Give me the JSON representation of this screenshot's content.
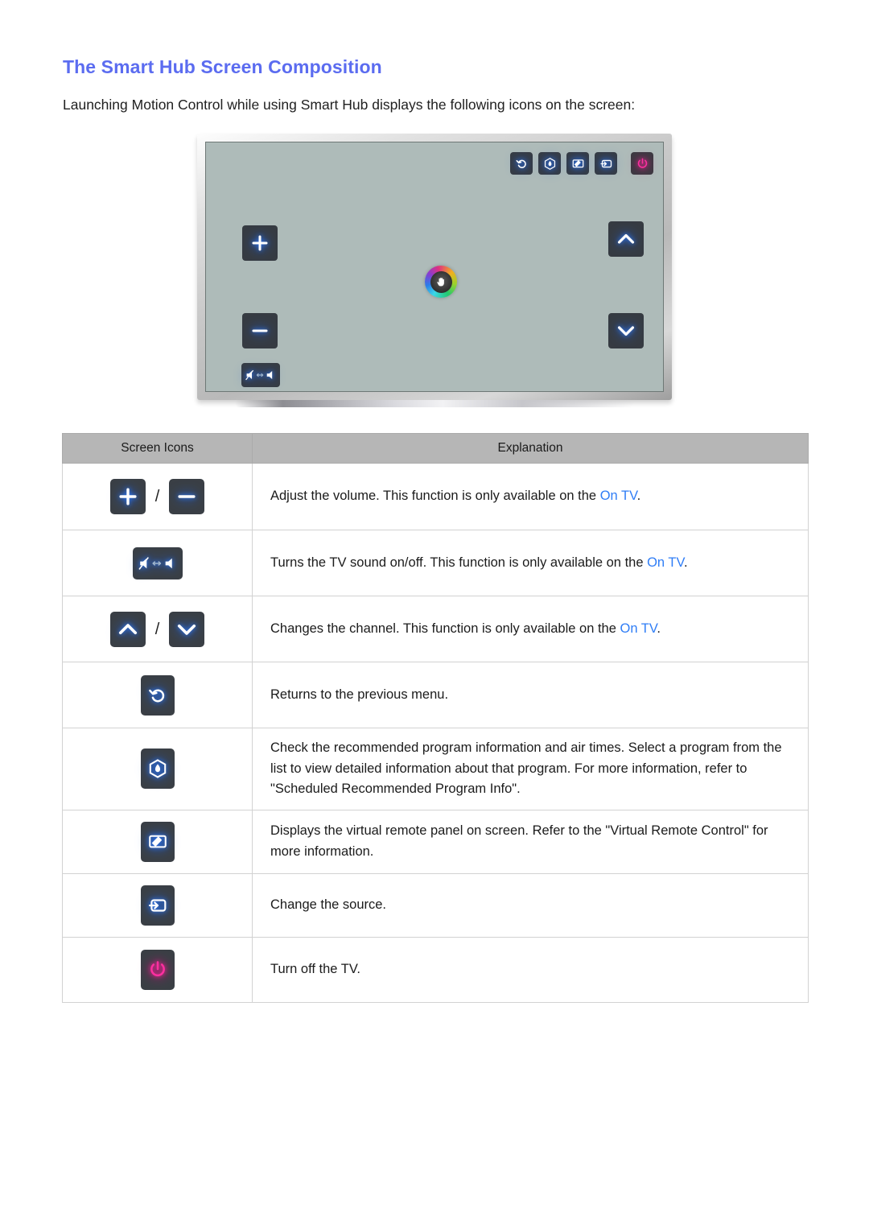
{
  "document": {
    "title": "The Smart Hub Screen Composition",
    "intro": "Launching Motion Control while using Smart Hub displays the following icons on the screen:"
  },
  "colors": {
    "title": "#5b6cf0",
    "link": "#2f7df6",
    "icon_glow_blue": "#2e7bff",
    "icon_glow_pink": "#ff2fa0",
    "icon_chip_bg": "#3a3f45",
    "tv_screen_bg": "#aebbb9",
    "table_header_bg": "#b6b6b6"
  },
  "tv_illustration": {
    "name": "smart-hub-tv-screen-mockup",
    "top_icons": [
      "return-icon",
      "recommendation-icon",
      "virtual-remote-icon",
      "source-icon",
      "power-icon"
    ],
    "left_icons": [
      "volume-up-icon",
      "volume-down-icon",
      "mute-toggle-icon"
    ],
    "right_icons": [
      "channel-up-icon",
      "channel-down-icon"
    ],
    "center_icon": "motion-control-hand-cursor-icon"
  },
  "table": {
    "headers": [
      "Screen Icons",
      "Explanation"
    ],
    "rows": [
      {
        "icons": [
          "volume-up-icon",
          "volume-down-icon"
        ],
        "separator": "/",
        "text_before": "Adjust the volume. This function is only available on the ",
        "link": "On TV",
        "text_after": "."
      },
      {
        "icons": [
          "mute-toggle-icon"
        ],
        "separator": "",
        "text_before": "Turns the TV sound on/off. This function is only available on the ",
        "link": "On TV",
        "text_after": "."
      },
      {
        "icons": [
          "channel-up-icon",
          "channel-down-icon"
        ],
        "separator": "/",
        "text_before": "Changes the channel. This function is only available on the ",
        "link": "On TV",
        "text_after": "."
      },
      {
        "icons": [
          "return-icon"
        ],
        "separator": "",
        "text_before": "Returns to the previous menu.",
        "link": "",
        "text_after": ""
      },
      {
        "icons": [
          "recommendation-icon"
        ],
        "separator": "",
        "text_before": "Check the recommended program information and air times. Select a program from the list to view detailed information about that program. For more information, refer to \"Scheduled Recommended Program Info\".",
        "link": "",
        "text_after": ""
      },
      {
        "icons": [
          "virtual-remote-icon"
        ],
        "separator": "",
        "text_before": "Displays the virtual remote panel on screen. Refer to the \"Virtual Remote Control\" for more information.",
        "link": "",
        "text_after": ""
      },
      {
        "icons": [
          "source-icon"
        ],
        "separator": "",
        "text_before": "Change the source.",
        "link": "",
        "text_after": ""
      },
      {
        "icons": [
          "power-icon"
        ],
        "separator": "",
        "text_before": "Turn off the TV.",
        "link": "",
        "text_after": ""
      }
    ]
  }
}
